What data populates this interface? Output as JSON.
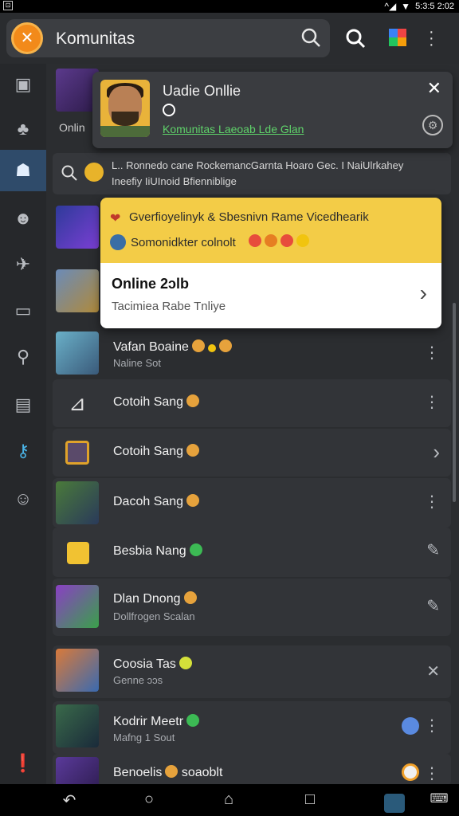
{
  "statusbar": {
    "time": "5:3:5 2:02"
  },
  "appbar": {
    "title": "Komunitas"
  },
  "popup": {
    "name": "Uadie Onllie",
    "link": "Komunitas Laeoab Lde Glan"
  },
  "search_strip": {
    "line1": "L.. Ronnedo cane RockemancGarnta Hoaro Gec. I NaiUlrkahey",
    "line2": "Ineefiy IiUInoid Bfienniblige"
  },
  "left_partial": {
    "label": "Onlin"
  },
  "card": {
    "top_line1": "Gverfioyelinyk & Sbesnivn Rame Vicedhearik",
    "top_line2": "Somonidkter colnolt",
    "bottom_title": "Online 2ɔlb",
    "bottom_sub": "Tacimiea Rabe Tnliye"
  },
  "rows": [
    {
      "title": "Vafan Boaine",
      "sub": "Naline Sot",
      "action": "more"
    },
    {
      "title": "Cotoih Sang",
      "sub": "",
      "action": "more"
    },
    {
      "title": "Cotoih Sang",
      "sub": "",
      "action": "chevron"
    },
    {
      "title": "Dacoh Sang",
      "sub": "",
      "action": "more"
    },
    {
      "title": "Besbia Nang",
      "sub": "",
      "action": "edit"
    },
    {
      "title": "Dlan Dnong",
      "sub": "Dollfrogen Scalan",
      "action": "edit"
    },
    {
      "title": "Coosia Tas",
      "sub": "Genne ɔɔs",
      "action": "close"
    },
    {
      "title": "Kodrir Meetr",
      "sub": "Mafng 1 Sout",
      "action": "more"
    },
    {
      "title": "Benoelis",
      "sub": "",
      "title_suffix": "soaoblt",
      "action": "more"
    }
  ],
  "colors": {
    "accent_yellow": "#f3cc47",
    "sidebar_active": "#2f4b6a",
    "link_green": "#5fd36a",
    "logo_orange": "#f28a1a"
  }
}
